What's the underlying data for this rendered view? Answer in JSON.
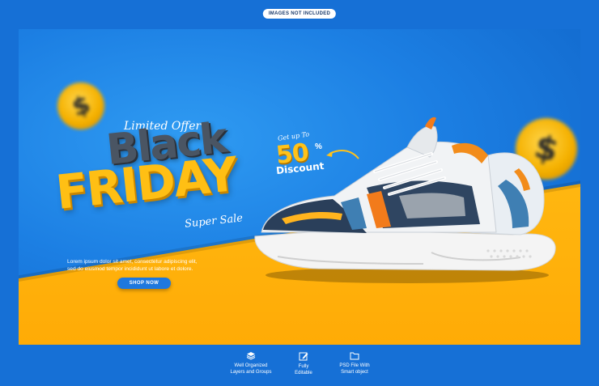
{
  "top_badge": "IMAGES NOT INCLUDED",
  "banner": {
    "limited_offer": "Limited Offer",
    "headline_black": "Black",
    "headline_friday": "FRIDAY",
    "super_sale": "Super Sale",
    "description_line1": "Lorem ipsum dolor sit amet, consectetur adipiscing elit,",
    "description_line2": "sed do eiusmod tempor incididunt ut labore et dolore.",
    "cta_label": "SHOP NOW",
    "offer_prefix": "Get up To",
    "offer_value": "50",
    "offer_unit": "%",
    "offer_label": "Discount",
    "coin_symbol": "$"
  },
  "colors": {
    "background": "#1670d6",
    "banner_blue": "#1c7fe3",
    "banner_yellow": "#ffc21a",
    "headline_gray": "#4a5563",
    "headline_yellow": "#ffbf14"
  },
  "features": [
    {
      "icon": "layers-icon",
      "line1": "Well Organized",
      "line2": "Layers and Groups"
    },
    {
      "icon": "edit-icon",
      "line1": "Fully",
      "line2": "Editable"
    },
    {
      "icon": "folder-icon",
      "line1": "PSD File With",
      "line2": "Smart object"
    }
  ]
}
